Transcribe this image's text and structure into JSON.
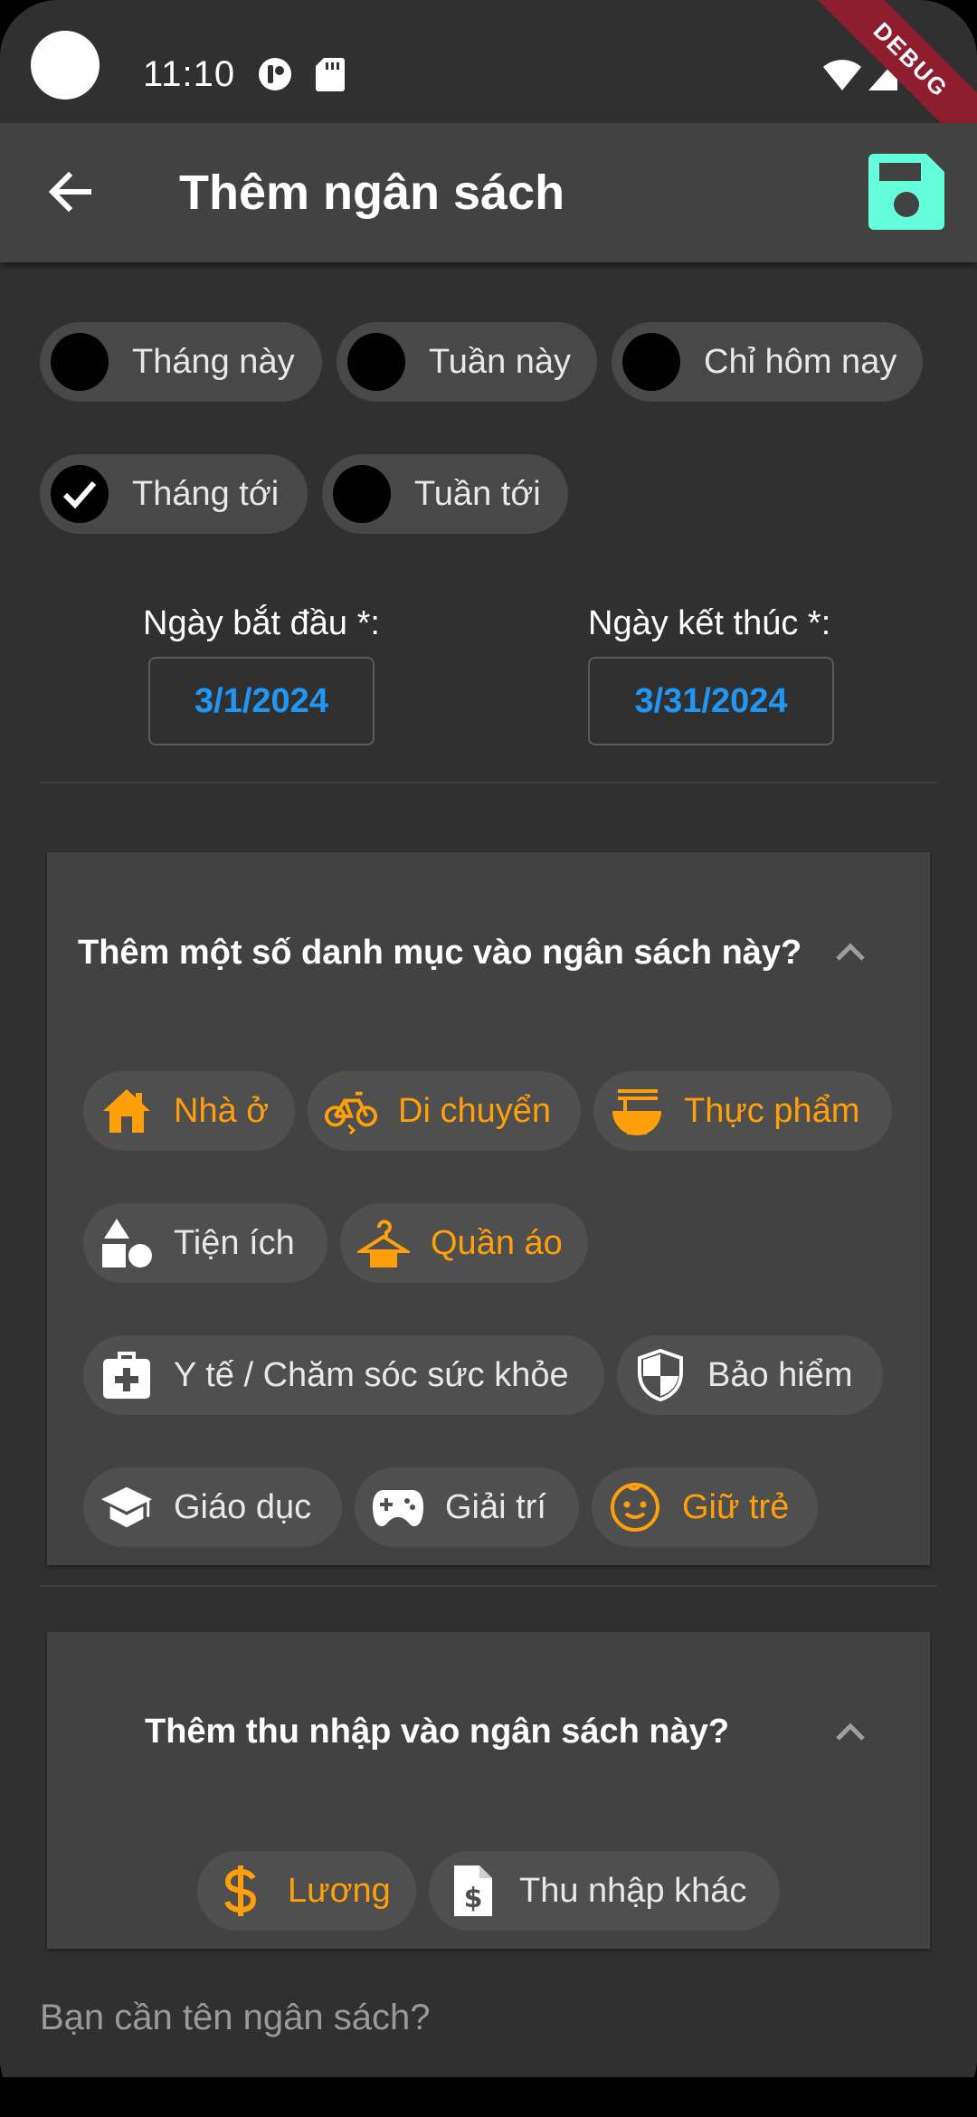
{
  "status_bar": {
    "time": "11:10",
    "debug_banner": "DEBUG"
  },
  "app_bar": {
    "title": "Thêm ngân sách",
    "back_icon": "arrow-left-icon",
    "save_icon": "save-floppy-icon"
  },
  "periods": [
    {
      "label": "Tháng này",
      "selected": false
    },
    {
      "label": "Tuần này",
      "selected": false
    },
    {
      "label": "Chỉ hôm nay",
      "selected": false
    },
    {
      "label": "Tháng tới",
      "selected": true
    },
    {
      "label": "Tuần tới",
      "selected": false
    }
  ],
  "dates": {
    "start_label": "Ngày bắt đầu *:",
    "start_value": "3/1/2024",
    "end_label": "Ngày kết thúc *:",
    "end_value": "3/31/2024"
  },
  "categories_panel": {
    "title": "Thêm một số danh mục vào ngân sách này?",
    "items": [
      {
        "label": "Nhà ở",
        "icon": "house-icon",
        "selected": true
      },
      {
        "label": "Di chuyển",
        "icon": "bicycle-icon",
        "selected": true
      },
      {
        "label": "Thực phẩm",
        "icon": "noodle-bowl-icon",
        "selected": true
      },
      {
        "label": "Tiện ích",
        "icon": "shapes-icon",
        "selected": false
      },
      {
        "label": "Quần áo",
        "icon": "clothes-hanger-icon",
        "selected": true
      },
      {
        "label": "Y tế / Chăm sóc sức khỏe",
        "icon": "medical-kit-icon",
        "selected": false
      },
      {
        "label": "Bảo hiểm",
        "icon": "shield-icon",
        "selected": false
      },
      {
        "label": "Giáo dục",
        "icon": "graduation-cap-icon",
        "selected": false
      },
      {
        "label": "Giải trí",
        "icon": "gamepad-icon",
        "selected": false
      },
      {
        "label": "Giữ trẻ",
        "icon": "baby-face-icon",
        "selected": true
      }
    ]
  },
  "income_panel": {
    "title": "Thêm thu nhập vào ngân sách này?",
    "items": [
      {
        "label": "Lương",
        "icon": "dollar-icon",
        "selected": true
      },
      {
        "label": "Thu nhập khác",
        "icon": "invoice-icon",
        "selected": false
      }
    ]
  },
  "name_field": {
    "placeholder": "Bạn cần tên ngân sách?"
  },
  "colors": {
    "accent_orange": "#ff9f0a",
    "save_green": "#64ffda",
    "date_blue": "#2196f3"
  }
}
